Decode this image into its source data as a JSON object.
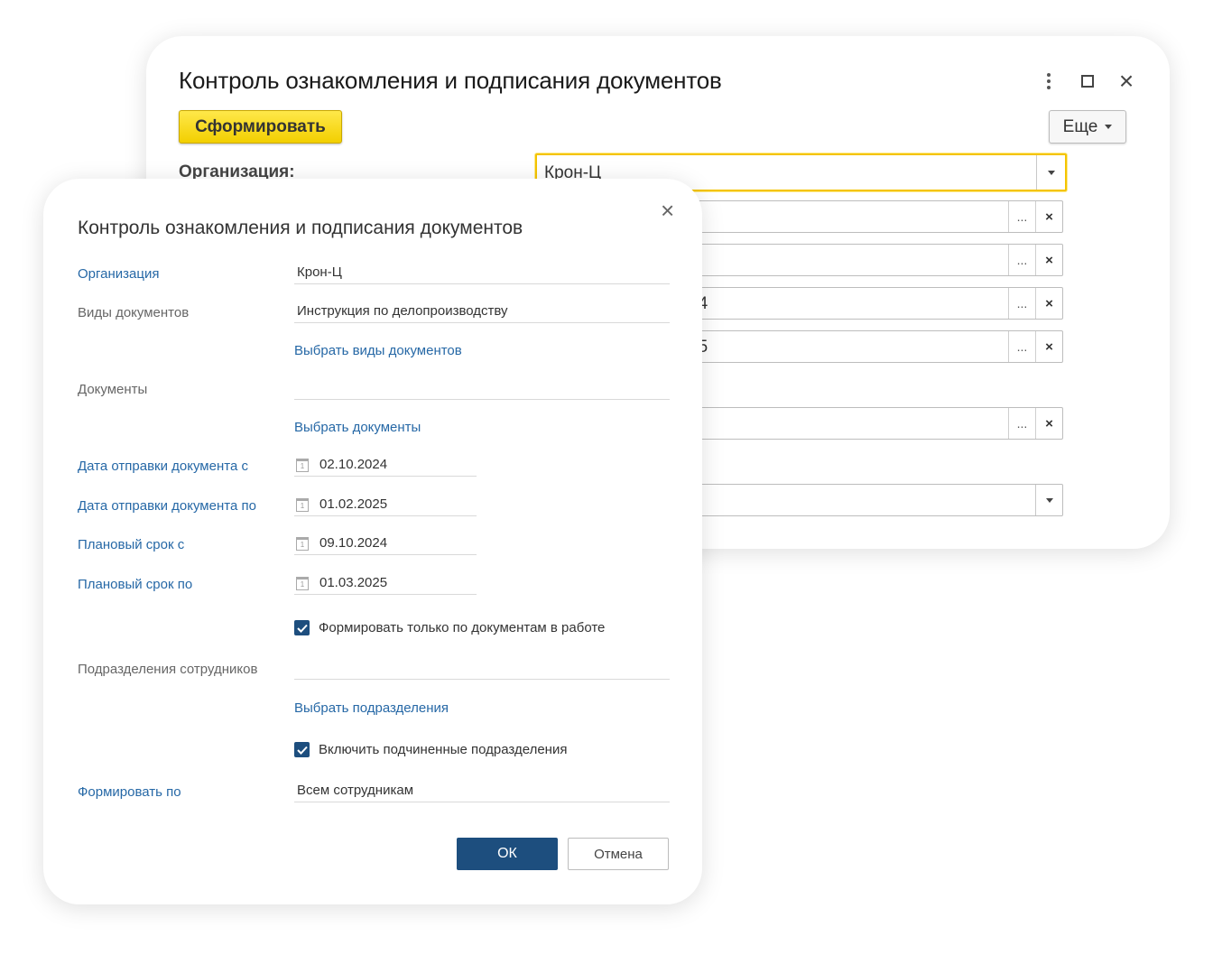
{
  "background_window": {
    "title": "Контроль ознакомления и подписания документов",
    "generate_button": "Сформировать",
    "more_button": "Еще",
    "organization_label": "Организация:",
    "organization_value": "Крон-Ц",
    "fields": [
      {
        "value": "",
        "dots": "...",
        "clear": "×"
      },
      {
        "value": "",
        "dots": "...",
        "clear": "×"
      },
      {
        "value": "24",
        "dots": "...",
        "clear": "×"
      },
      {
        "value": "25",
        "dots": "...",
        "clear": "×"
      },
      {
        "value": "",
        "dots": "...",
        "clear": "×"
      }
    ]
  },
  "dialog": {
    "title": "Контроль ознакомления и подписания документов",
    "close": "×",
    "organization": {
      "label": "Организация",
      "value": "Крон-Ц"
    },
    "doc_types": {
      "label": "Виды документов",
      "value": "Инструкция по делопроизводству",
      "action": "Выбрать виды документов"
    },
    "documents": {
      "label": "Документы",
      "value": "",
      "action": "Выбрать документы"
    },
    "send_date_from": {
      "label": "Дата отправки документа с",
      "value": "02.10.2024"
    },
    "send_date_to": {
      "label": "Дата отправки документа по",
      "value": "01.02.2025"
    },
    "plan_from": {
      "label": "Плановый срок с",
      "value": "09.10.2024"
    },
    "plan_to": {
      "label": "Плановый срок по",
      "value": "01.03.2025"
    },
    "only_in_work": {
      "label": "Формировать только по документам в работе",
      "checked": true
    },
    "departments": {
      "label": "Подразделения сотрудников",
      "value": "",
      "action": "Выбрать подразделения"
    },
    "include_sub": {
      "label": "Включить подчиненные подразделения",
      "checked": true
    },
    "generate_by": {
      "label": "Формировать по",
      "value": "Всем сотрудникам"
    },
    "ok_button": "ОК",
    "cancel_button": "Отмена"
  },
  "colors": {
    "accent_yellow": "#f4c400",
    "primary_blue": "#1d4e7e",
    "link_blue": "#2668a6"
  }
}
